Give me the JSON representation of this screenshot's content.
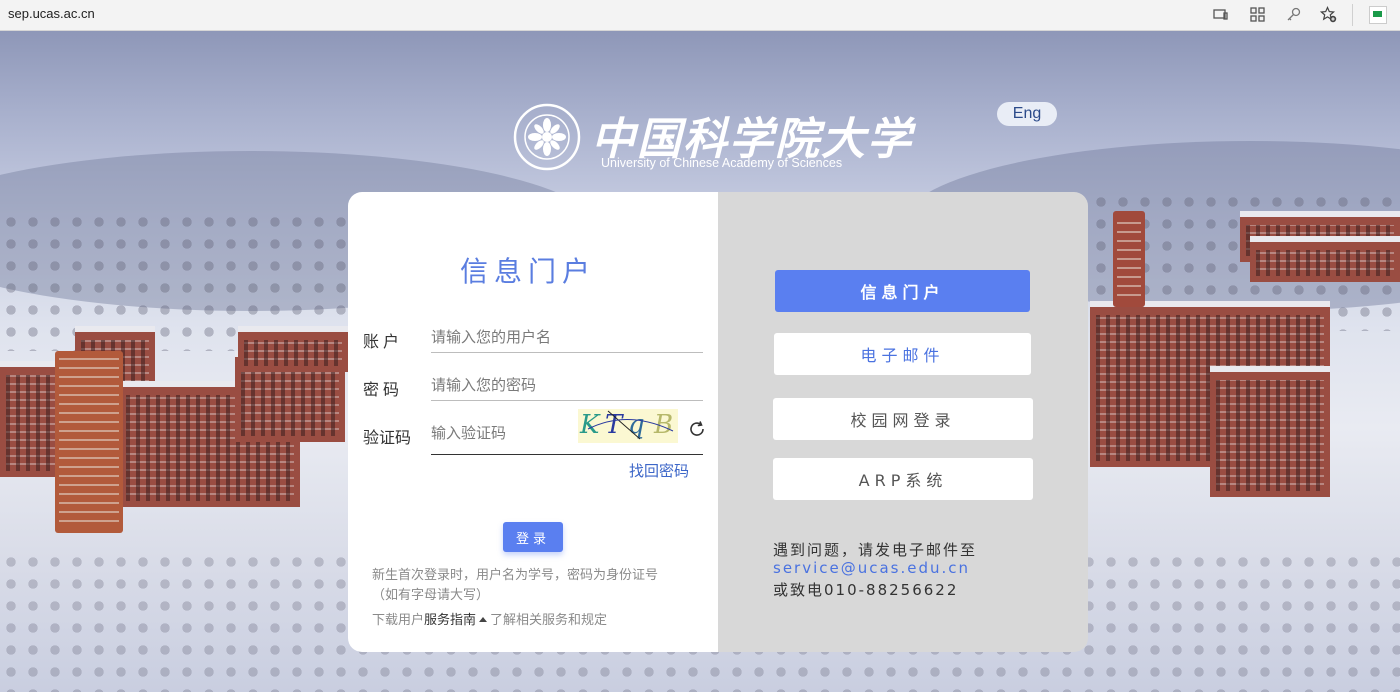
{
  "browser": {
    "url": "sep.ucas.ac.cn",
    "icons": [
      "cast-icon",
      "apps-icon",
      "key-icon",
      "star-add-icon",
      "extension-icon"
    ]
  },
  "header": {
    "logo_cn": "中国科学院大学",
    "logo_en": "University of Chinese Academy of Sciences",
    "lang_button": "Eng"
  },
  "login": {
    "title": "信息门户",
    "account_label": "账户",
    "account_placeholder": "请输入您的用户名",
    "password_label": "密码",
    "password_placeholder": "请输入您的密码",
    "captcha_label": "验证码",
    "captcha_placeholder": "输入验证码",
    "captcha_chars": [
      "K",
      "T",
      "q",
      "B"
    ],
    "forgot_link": "找回密码",
    "login_button": "登录",
    "note_line1": "新生首次登录时，用户名为学号，密码为身份证号",
    "note_line2": "（如有字母请大写）",
    "guide_prefix": "下载用户",
    "guide_link": "服务指南",
    "guide_suffix": "了解相关服务和规定"
  },
  "side": {
    "buttons": [
      "信息门户",
      "电子邮件",
      "校园网登录",
      "ARP系统"
    ],
    "active_index": 0,
    "contact_line1": "遇到问题，请发电子邮件至",
    "contact_email": "service@ucas.edu.cn",
    "contact_line2": "或致电010-88256622"
  },
  "colors": {
    "accent": "#5a7ff0",
    "title": "#5a7de0",
    "link": "#3c66c8"
  }
}
